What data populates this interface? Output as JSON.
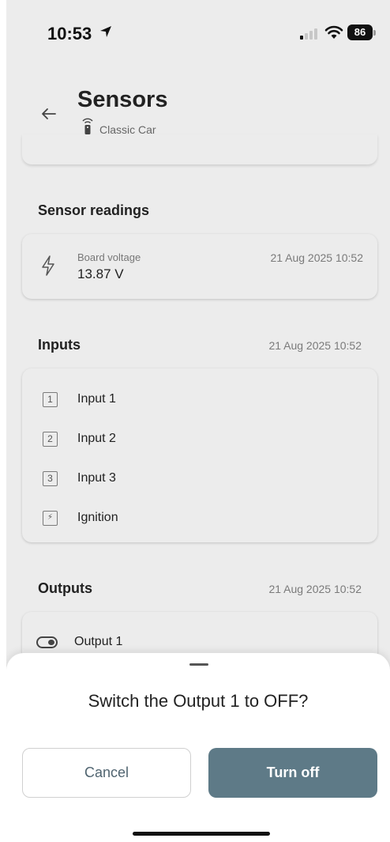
{
  "status_bar": {
    "time": "10:53",
    "battery": "86"
  },
  "header": {
    "title": "Sensors",
    "device_name": "Classic Car"
  },
  "sensor_readings": {
    "section_title": "Sensor readings",
    "items": [
      {
        "label": "Board voltage",
        "value": "13.87 V",
        "timestamp": "21 Aug 2025 10:52",
        "icon": "bolt-icon"
      }
    ]
  },
  "inputs": {
    "section_title": "Inputs",
    "timestamp": "21 Aug 2025 10:52",
    "items": [
      {
        "icon_text": "1",
        "label": "Input 1"
      },
      {
        "icon_text": "2",
        "label": "Input 2"
      },
      {
        "icon_text": "3",
        "label": "Input 3"
      },
      {
        "icon_text": "⚡",
        "label": "Ignition"
      }
    ]
  },
  "outputs": {
    "section_title": "Outputs",
    "timestamp": "21 Aug 2025 10:52",
    "items": [
      {
        "label": "Output 1",
        "icon": "toggle-icon"
      }
    ]
  },
  "dialog": {
    "question": "Switch the Output 1 to OFF?",
    "cancel_label": "Cancel",
    "confirm_label": "Turn off"
  },
  "colors": {
    "background": "#ececec",
    "primary_button": "#5e7a87",
    "cancel_text": "#506470"
  }
}
